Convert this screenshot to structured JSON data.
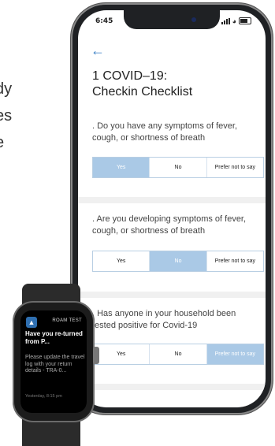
{
  "background_text": [
    "dy",
    "es",
    "e"
  ],
  "status_bar": {
    "time": "6:45"
  },
  "page": {
    "back_icon": "arrow-left-icon",
    "title_line1": "1 COVID–19:",
    "title_line2": "Checkin Checklist"
  },
  "questions": [
    {
      "text": ". Do you have any symptoms of fever, cough, or shortness of breath",
      "options": [
        "Yes",
        "No",
        "Prefer not to say"
      ],
      "selected": "Yes"
    },
    {
      "text": ". Are you developing symptoms of fever, cough, or shortness of breath",
      "options": [
        "Yes",
        "No",
        "Prefer not to say"
      ],
      "selected": "No"
    },
    {
      "text": ". Has anyone in your household been tested positive for Covid-19",
      "options": [
        "Yes",
        "No",
        "Prefer not to say"
      ],
      "selected": "Prefer not to say"
    }
  ],
  "watch": {
    "app_name": "ROAM TEST",
    "title": "Have you re-turned from P...",
    "body": "Please update the travel log with your return details - TRA-0...",
    "timestamp": "Yesterday, 8:15 pm"
  },
  "colors": {
    "accent": "#3a7fc4",
    "selected": "#aac9e6"
  }
}
